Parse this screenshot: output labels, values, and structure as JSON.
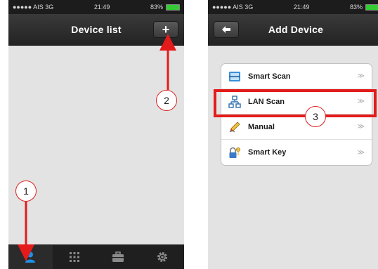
{
  "left_phone": {
    "status": {
      "carrier": "●●●●● AIS  3G",
      "time": "21:49",
      "battery": "83%"
    },
    "nav_title": "Device list",
    "add_button_label": "+",
    "tabs": [
      {
        "name": "person-icon",
        "active": true
      },
      {
        "name": "grid-icon",
        "active": false
      },
      {
        "name": "briefcase-icon",
        "active": false
      },
      {
        "name": "gear-icon",
        "active": false
      }
    ]
  },
  "right_phone": {
    "status": {
      "carrier": "●●●●● AIS  3G",
      "time": "21:49",
      "battery": "83%"
    },
    "nav_title": "Add Device",
    "menu": [
      {
        "label": "Smart Scan",
        "icon": "scan-icon",
        "chevron": "≫"
      },
      {
        "label": "LAN Scan",
        "icon": "network-icon",
        "chevron": "≫"
      },
      {
        "label": "Manual",
        "icon": "pencil-icon",
        "chevron": "≫"
      },
      {
        "label": "Smart Key",
        "icon": "key-lock-icon",
        "chevron": "≫"
      }
    ]
  },
  "annotations": {
    "callout_1": "1",
    "callout_2": "2",
    "callout_3": "3",
    "color": "#e31b1b"
  }
}
